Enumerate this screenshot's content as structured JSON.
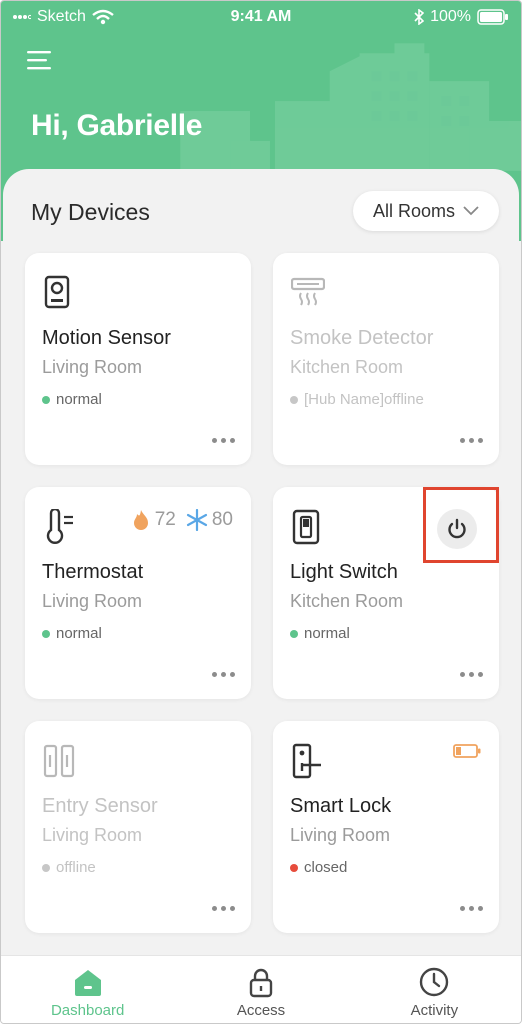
{
  "status_bar": {
    "carrier": "Sketch",
    "time": "9:41 AM",
    "battery": "100%"
  },
  "header": {
    "greeting": "Hi, Gabrielle"
  },
  "devices_section": {
    "title": "My Devices",
    "room_filter": "All Rooms"
  },
  "devices": [
    {
      "name": "Motion Sensor",
      "room": "Living Room",
      "status": "normal",
      "status_color": "#5ec48c",
      "icon": "motion-sensor-icon",
      "offline": false
    },
    {
      "name": "Smoke Detector",
      "room": "Kitchen Room",
      "status": "[Hub Name]offline",
      "status_color": "#c7c7c7",
      "icon": "smoke-detector-icon",
      "offline": true
    },
    {
      "name": "Thermostat",
      "room": "Living Room",
      "status": "normal",
      "status_color": "#5ec48c",
      "icon": "thermostat-icon",
      "offline": false,
      "heat": "72",
      "cool": "80"
    },
    {
      "name": "Light Switch",
      "room": "Kitchen Room",
      "status": "normal",
      "status_color": "#5ec48c",
      "icon": "light-switch-icon",
      "offline": false
    },
    {
      "name": "Entry Sensor",
      "room": "Living Room",
      "status": "offline",
      "status_color": "#c7c7c7",
      "icon": "entry-sensor-icon",
      "offline": true
    },
    {
      "name": "Smart Lock",
      "room": "Living Room",
      "status": "closed",
      "status_color": "#e74c3c",
      "icon": "smart-lock-icon",
      "offline": false,
      "battery_status": "low"
    }
  ],
  "tabs": [
    {
      "label": "Dashboard",
      "icon": "home-icon",
      "active": true
    },
    {
      "label": "Access",
      "icon": "lock-icon",
      "active": false
    },
    {
      "label": "Activity",
      "icon": "clock-icon",
      "active": false
    }
  ],
  "colors": {
    "brand": "#5ec48c",
    "alert": "#e74c3c",
    "warning": "#f0a35e",
    "highlight": "#e0452f"
  }
}
